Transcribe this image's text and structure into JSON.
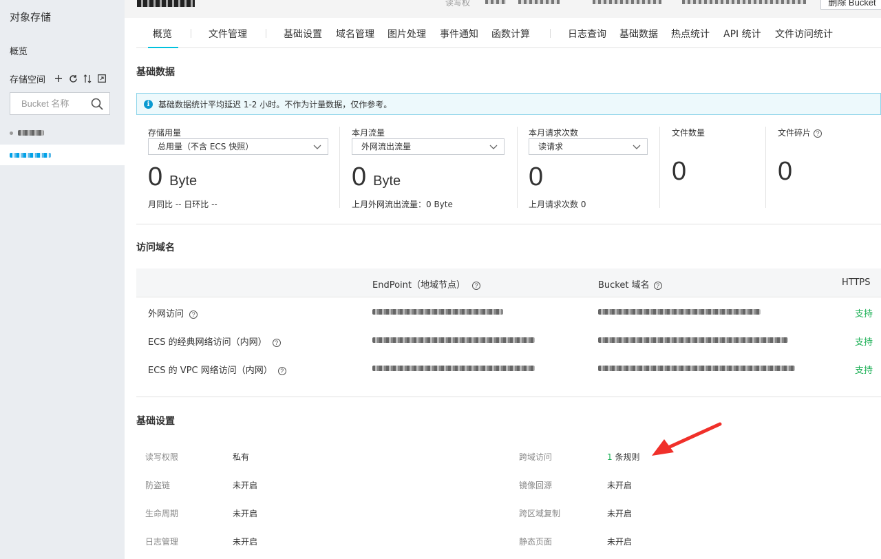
{
  "sidebar": {
    "title": "对象存储",
    "overview": "概览",
    "storage_space": "存储空间",
    "search_placeholder": "Bucket 名称",
    "icons": [
      "plus-icon",
      "refresh-icon",
      "sort-icon",
      "expand-icon",
      "search-icon"
    ]
  },
  "topbar": {
    "rw_label": "读写权",
    "delete_button": "删除 Bucket"
  },
  "tabs": [
    {
      "label": "概览",
      "active": true
    },
    {
      "label": "文件管理"
    },
    {
      "label": "基础设置"
    },
    {
      "label": "域名管理"
    },
    {
      "label": "图片处理"
    },
    {
      "label": "事件通知"
    },
    {
      "label": "函数计算"
    },
    {
      "label": "日志查询"
    },
    {
      "label": "基础数据"
    },
    {
      "label": "热点统计"
    },
    {
      "label": "API 统计"
    },
    {
      "label": "文件访问统计"
    }
  ],
  "basic_data": {
    "title": "基础数据",
    "notice": "基础数据统计平均延迟 1-2 小时。不作为计量数据，仅作参考。",
    "stats": [
      {
        "label": "存储用量",
        "select": "总用量（不含 ECS 快照）",
        "value": "0",
        "unit": "Byte",
        "sub": "月同比 --   日环比 --"
      },
      {
        "label": "本月流量",
        "select": "外网流出流量",
        "value": "0",
        "unit": "Byte",
        "sub": "上月外网流出流量：0 Byte"
      },
      {
        "label": "本月请求次数",
        "select": "读请求",
        "value": "0",
        "unit": "",
        "sub": "上月请求次数  0"
      },
      {
        "label": "文件数量",
        "value": "0"
      },
      {
        "label": "文件碎片",
        "value": "0"
      }
    ]
  },
  "access_domain": {
    "title": "访问域名",
    "headers": {
      "endpoint": "EndPoint（地域节点）",
      "bucket_domain": "Bucket 域名",
      "https": "HTTPS"
    },
    "rows": [
      {
        "name": "外网访问",
        "https": "支持"
      },
      {
        "name": "ECS 的经典网络访问（内网）",
        "https": "支持"
      },
      {
        "name": "ECS 的 VPC 网络访问（内网）",
        "https": "支持"
      }
    ]
  },
  "basic_settings": {
    "title": "基础设置",
    "left": [
      {
        "label": "读写权限",
        "value": "私有"
      },
      {
        "label": "防盗链",
        "value": "未开启"
      },
      {
        "label": "生命周期",
        "value": "未开启"
      },
      {
        "label": "日志管理",
        "value": "未开启"
      }
    ],
    "right": [
      {
        "label": "跨域访问",
        "count": "1",
        "value": "条规则"
      },
      {
        "label": "镜像回源",
        "value": "未开启"
      },
      {
        "label": "跨区域复制",
        "value": "未开启"
      },
      {
        "label": "静态页面",
        "value": "未开启"
      }
    ]
  },
  "colors": {
    "accent": "#00c1de",
    "green": "#1aaf54",
    "arrow": "#f0302a"
  }
}
